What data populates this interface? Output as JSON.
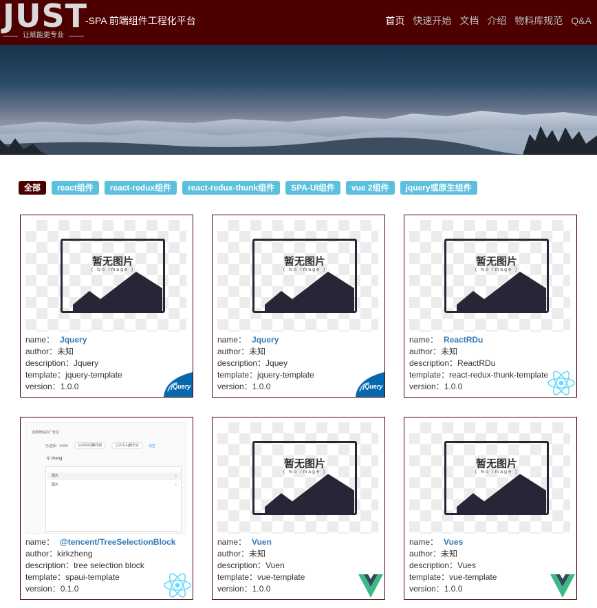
{
  "header": {
    "logo_text": "JUST",
    "slogan": "让赋能更专业",
    "subtitle": "-SPA 前端组件工程化平台",
    "nav": [
      {
        "label": "首页",
        "active": true
      },
      {
        "label": "快速开始",
        "active": false
      },
      {
        "label": "文档",
        "active": false
      },
      {
        "label": "介绍",
        "active": false
      },
      {
        "label": "物料库规范",
        "active": false
      },
      {
        "label": "Q&A",
        "active": false
      }
    ]
  },
  "filters": [
    {
      "label": "全部",
      "active": true
    },
    {
      "label": "react组件",
      "active": false
    },
    {
      "label": "react-redux组件",
      "active": false
    },
    {
      "label": "react-redux-thunk组件",
      "active": false
    },
    {
      "label": "SPA-UI组件",
      "active": false
    },
    {
      "label": "vue 2组件",
      "active": false
    },
    {
      "label": "jquery或原生组件",
      "active": false
    }
  ],
  "labels": {
    "name": "name：",
    "author": "author：",
    "description": "description：",
    "template": "template：",
    "version": "version："
  },
  "placeholder": {
    "title": "暂无图片",
    "subtitle": "( No image )"
  },
  "screenshot": {
    "title": "选择微信的广告位",
    "selected": "已选择：1/400",
    "pill1": "[628000]腾讯新",
    "pill2": "[120114]腾讯云",
    "link": "清空",
    "search": "chang",
    "rows": [
      "图片",
      "图片"
    ]
  },
  "badges": {
    "jquery": "jQuery"
  },
  "cards": [
    {
      "name": "Jquery",
      "author": "未知",
      "description": "Jquery",
      "template": "jquery-template",
      "version": "1.0.0",
      "badge": "jquery-logo-icon"
    },
    {
      "name": "Jquery",
      "author": "未知",
      "description": "Jquey",
      "template": "jquery-template",
      "version": "1.0.0",
      "badge": "jquery-logo-icon"
    },
    {
      "name": "ReactRDu",
      "author": "未知",
      "description": "ReactRDu",
      "template": "react-redux-thunk-template",
      "version": "1.0.0",
      "badge": "react-logo-icon"
    },
    {
      "name": "@tencent/TreeSelectionBlock",
      "author": "kirkzheng",
      "description": "tree selection block",
      "template": "spaui-template",
      "version": "0.1.0",
      "badge": "react-logo-icon"
    },
    {
      "name": "Vuen",
      "author": "未知",
      "description": "Vuen",
      "template": "vue-template",
      "version": "1.0.0",
      "badge": "vue-logo-icon"
    },
    {
      "name": "Vues",
      "author": "未知",
      "description": "Vues",
      "template": "vue-template",
      "version": "1.0.0",
      "badge": "vue-logo-icon"
    }
  ],
  "colors": {
    "header_bg": "#4d0000",
    "filter_tag": "#5bc0de",
    "link": "#337ab7",
    "jquery_blue": "#0769ad",
    "react_cyan": "#61dafb",
    "vue_green": "#41b883",
    "vue_dark": "#34495e"
  }
}
